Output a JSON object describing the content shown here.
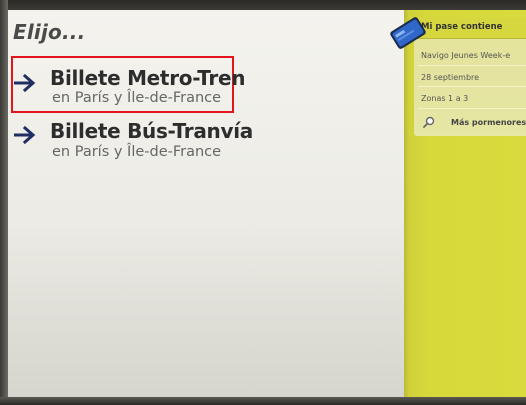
{
  "main": {
    "heading": "Elijo...",
    "options": [
      {
        "title": "Billete Metro-Tren",
        "subtitle": "en París y Île-de-France",
        "icon": "arrow-right-icon",
        "selected": true
      },
      {
        "title": "Billete Bús-Tranvía",
        "subtitle": "en París y Île-de-France",
        "icon": "arrow-right-icon",
        "selected": false
      }
    ]
  },
  "pass_panel": {
    "icon": "navigo-card-icon",
    "title": "Mi pase contiene",
    "lines": [
      "Navigo Jeunes Week-e",
      "28 septiembre",
      "Zonas 1 a 3"
    ],
    "details_icon": "magnifier-icon",
    "details_label": "Más pormenores"
  },
  "colors": {
    "panel_yellow": "#d9da3d",
    "highlight_red": "#e3141b",
    "arrow_navy": "#1f2f63",
    "card_blue": "#2f68c8"
  }
}
